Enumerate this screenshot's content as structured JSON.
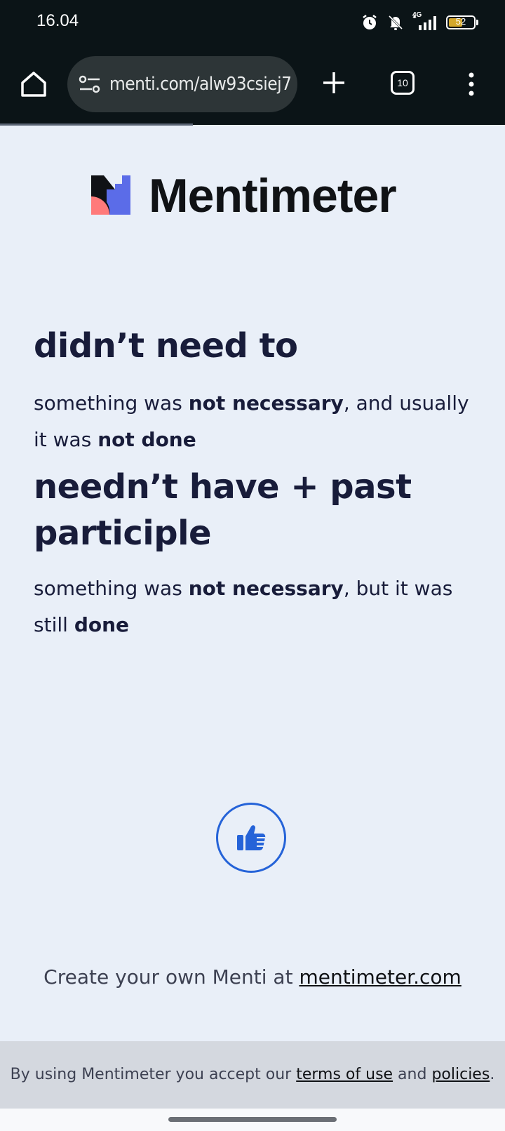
{
  "status_bar": {
    "time": "16.04",
    "network": "4G",
    "battery": "52"
  },
  "browser": {
    "url": "menti.com/alw93csiej7",
    "tab_count": "10"
  },
  "brand": {
    "name": "Mentimeter"
  },
  "content": {
    "heading1": "didn’t need to",
    "para1": {
      "t1": "something was ",
      "b1": "not necessary",
      "t2": ", and usually it was ",
      "b2": "not done"
    },
    "heading2": "needn’t have + past participle",
    "para2": {
      "t1": "something was ",
      "b1": "not necessary",
      "t2": ", but  it was still ",
      "b2": "done"
    }
  },
  "reaction": {
    "icon": "thumbs-up-icon",
    "color": "#2563d8"
  },
  "create": {
    "prefix": "Create your own Menti at ",
    "link": "mentimeter.com"
  },
  "footer": {
    "t1": "By using Mentimeter you accept our ",
    "terms": "terms of use",
    "t2": " and ",
    "policies": "policies",
    "t3": "."
  },
  "colors": {
    "page_bg": "#e9eff8",
    "chrome_bg": "#0b1417",
    "text": "#181c3a",
    "accent": "#2563d8"
  }
}
